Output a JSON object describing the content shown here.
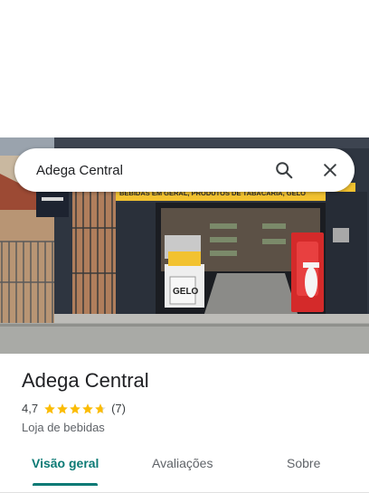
{
  "search": {
    "value": "Adega Central"
  },
  "place": {
    "name": "Adega Central",
    "rating": "4,7",
    "stars": 4.7,
    "reviews": "(7)",
    "category": "Loja de bebidas"
  },
  "photo_signs": {
    "banner": "BEBIDAS EM GERAL, PRODUTOS DE TABACARIA, GELO",
    "gelo": "GELO"
  },
  "tabs": [
    {
      "label": "Visão geral"
    },
    {
      "label": "Avaliações"
    },
    {
      "label": "Sobre"
    }
  ],
  "colors": {
    "accent": "#0b7a75",
    "star": "#fbbc04"
  }
}
